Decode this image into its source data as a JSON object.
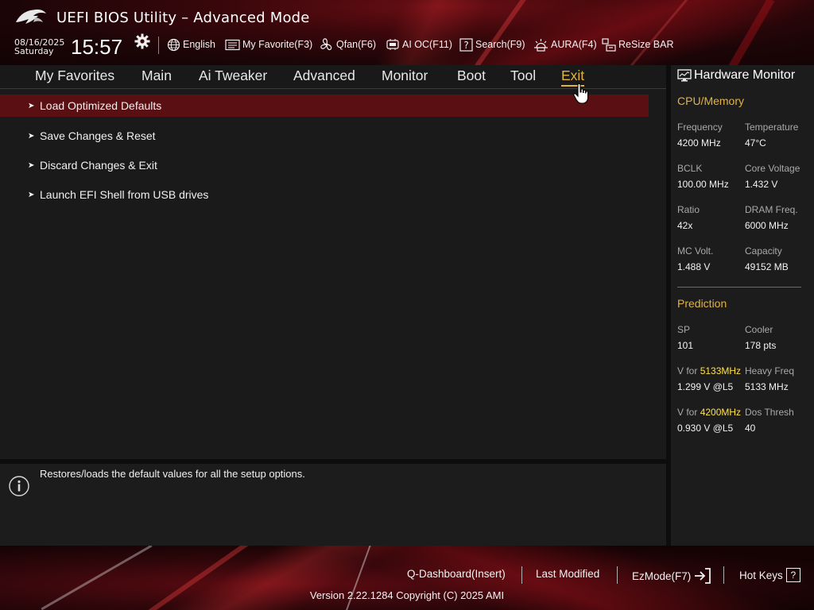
{
  "header": {
    "title": "UEFI BIOS Utility – Advanced Mode",
    "date": "08/16/2025",
    "day": "Saturday",
    "time": "15:57",
    "tools": [
      {
        "label": "English",
        "icon": "globe-icon"
      },
      {
        "label": "My Favorite(F3)",
        "icon": "favorite-list-icon"
      },
      {
        "label": "Qfan(F6)",
        "icon": "fan-icon"
      },
      {
        "label": "AI OC(F11)",
        "icon": "ai-oc-icon"
      },
      {
        "label": "Search(F9)",
        "icon": "search-help-icon"
      },
      {
        "label": "AURA(F4)",
        "icon": "aura-icon"
      },
      {
        "label": "ReSize BAR",
        "icon": "resize-bar-icon"
      }
    ]
  },
  "nav": {
    "tabs": [
      "My Favorites",
      "Main",
      "Ai Tweaker",
      "Advanced",
      "Monitor",
      "Boot",
      "Tool",
      "Exit"
    ],
    "active": "Exit"
  },
  "menu": {
    "items": [
      {
        "label": "Load Optimized Defaults",
        "selected": true
      },
      {
        "label": "Save Changes & Reset",
        "selected": false
      },
      {
        "label": "Discard Changes & Exit",
        "selected": false
      },
      {
        "label": "Launch EFI Shell from USB drives",
        "selected": false
      }
    ],
    "arrow": "➤"
  },
  "help": {
    "text": "Restores/loads the default values for all the setup options."
  },
  "hardware_monitor": {
    "title": "Hardware Monitor",
    "cpu_memory": {
      "heading": "CPU/Memory",
      "frequency_label": "Frequency",
      "frequency": "4200 MHz",
      "temperature_label": "Temperature",
      "temperature": "47°C",
      "bclk_label": "BCLK",
      "bclk": "100.00 MHz",
      "core_voltage_label": "Core Voltage",
      "core_voltage": "1.432 V",
      "ratio_label": "Ratio",
      "ratio": "42x",
      "dram_freq_label": "DRAM Freq.",
      "dram_freq": "6000 MHz",
      "mc_volt_label": "MC Volt.",
      "mc_volt": "1.488 V",
      "capacity_label": "Capacity",
      "capacity": "49152 MB"
    },
    "prediction": {
      "heading": "Prediction",
      "sp_label": "SP",
      "sp": "101",
      "cooler_label": "Cooler",
      "cooler": "178 pts",
      "v_for_prefix": "V for ",
      "v_for_1_freq": "5133MHz",
      "v_for_1": "1.299 V @L5",
      "heavy_freq_label": "Heavy Freq",
      "heavy_freq": "5133 MHz",
      "v_for_2_freq": "4200MHz",
      "v_for_2": "0.930 V @L5",
      "dos_thresh_label": "Dos Thresh",
      "dos_thresh": "40"
    }
  },
  "footer": {
    "q_dashboard": "Q-Dashboard(Insert)",
    "last_modified": "Last Modified",
    "ezmode": "EzMode(F7)",
    "hot_keys": "Hot Keys",
    "hot_keys_glyph": "?",
    "version": "Version 2.22.1284 Copyright (C) 2025 AMI"
  },
  "colors": {
    "accent": "#e3b341",
    "selected_row": "#5a0f12",
    "highlight": "#ffe14a"
  }
}
